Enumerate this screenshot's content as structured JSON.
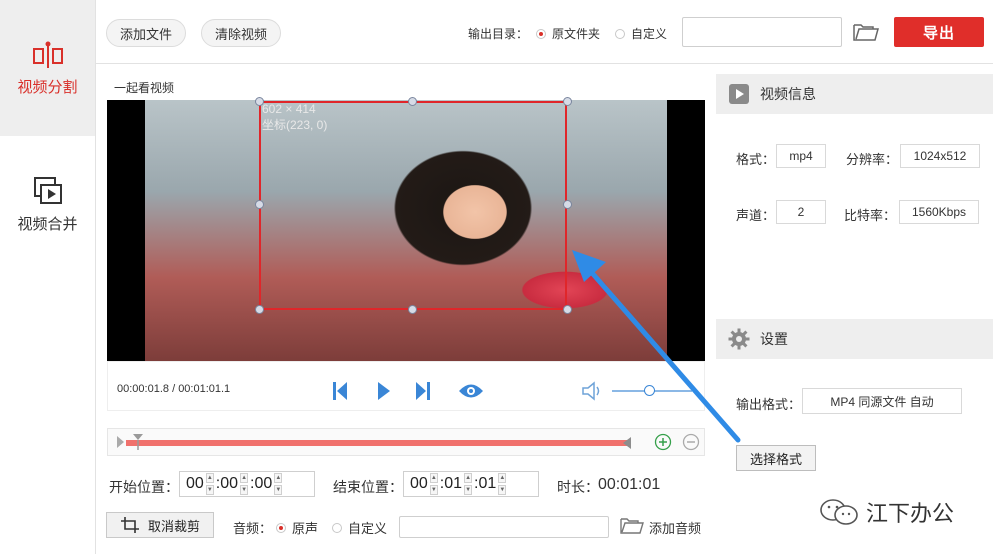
{
  "sidebar": {
    "items": [
      {
        "label": "视频分割",
        "icon": "split-icon",
        "active": true
      },
      {
        "label": "视频合并",
        "icon": "merge-icon",
        "active": false
      }
    ]
  },
  "toolbar": {
    "add_file": "添加文件",
    "clear_video": "清除视频",
    "output_dir_label": "输出目录：",
    "option_source_folder": "原文件夹",
    "option_custom": "自定义",
    "output_path_value": "",
    "export_label": "导出"
  },
  "video": {
    "title": "一起看视频",
    "overlay_size": "602 × 414",
    "overlay_coord": "坐标(223, 0)",
    "time_current": "00:00:01.8",
    "time_total": "00:01:01.1"
  },
  "trim": {
    "start_label": "开始位置：",
    "start": {
      "h": "00",
      "m": "00",
      "s": "00"
    },
    "end_label": "结束位置：",
    "end": {
      "h": "00",
      "m": "01",
      "s": "01"
    },
    "duration_label": "时长：",
    "duration": "00:01:01"
  },
  "bottom": {
    "cancel_crop": "取消裁剪",
    "audio_label": "音频：",
    "audio_original": "原声",
    "audio_custom": "自定义",
    "add_audio": "添加音频"
  },
  "video_info": {
    "title": "视频信息",
    "format_label": "格式：",
    "format": "mp4",
    "resolution_label": "分辨率：",
    "resolution": "1024x512",
    "channel_label": "声道：",
    "channel": "2",
    "bitrate_label": "比特率：",
    "bitrate": "1560Kbps"
  },
  "settings": {
    "title": "设置",
    "output_format_label": "输出格式：",
    "output_format": "MP4 同源文件 自动",
    "choose_format": "选择格式"
  },
  "watermark": {
    "text": "江下办公"
  },
  "colors": {
    "accent": "#d9302a",
    "export_bg": "#e02e2a",
    "crop_border": "#e0262a",
    "timeline_bar": "#f0716c",
    "play_blue": "#3a86d6",
    "arrow_blue": "#2f8be6"
  }
}
